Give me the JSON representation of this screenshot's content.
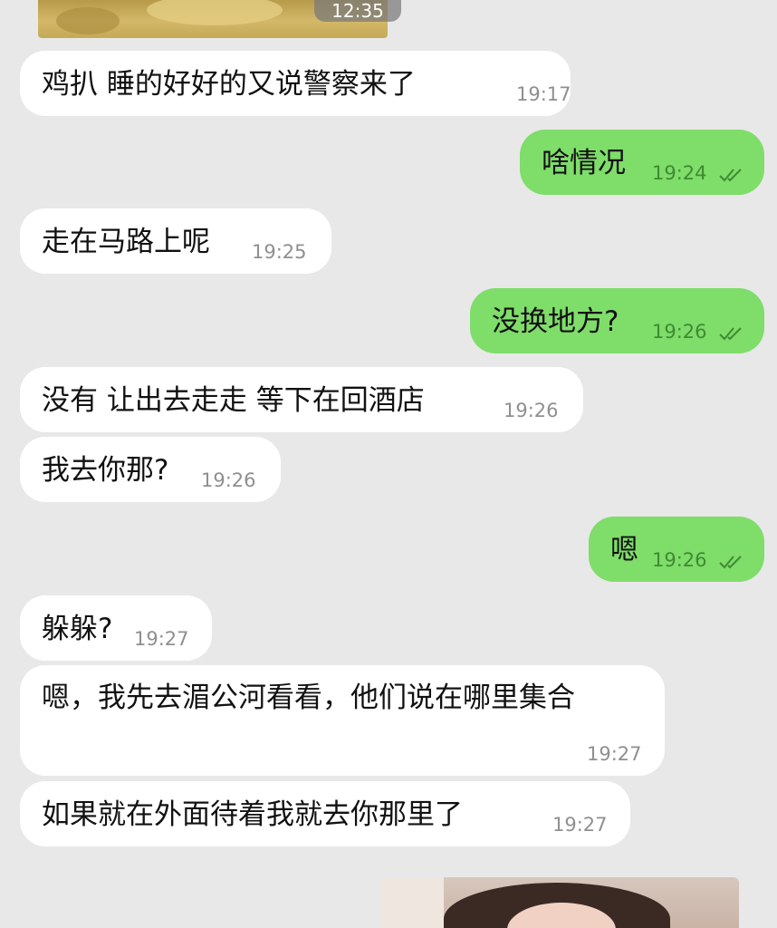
{
  "top_media": {
    "timestamp_overlay": "12:35"
  },
  "messages": [
    {
      "dir": "in",
      "text": "鸡扒 睡的好好的又说警察来了",
      "time": "19:17"
    },
    {
      "dir": "out",
      "text": "啥情况",
      "time": "19:24",
      "read": true
    },
    {
      "dir": "in",
      "text": "走在马路上呢",
      "time": "19:25"
    },
    {
      "dir": "out",
      "text": "没换地方?",
      "time": "19:26",
      "read": true
    },
    {
      "dir": "in",
      "text": "没有 让出去走走 等下在回酒店",
      "time": "19:26"
    },
    {
      "dir": "in",
      "text": "我去你那?",
      "time": "19:26"
    },
    {
      "dir": "out",
      "text": "嗯",
      "time": "19:26",
      "read": true
    },
    {
      "dir": "in",
      "text": "躲躲?",
      "time": "19:27"
    },
    {
      "dir": "in",
      "text": "嗯，我先去湄公河看看，他们说在哪里集合",
      "time": "19:27"
    },
    {
      "dir": "in",
      "text": "如果就在外面待着我就去你那里了",
      "time": "19:27"
    }
  ],
  "colors": {
    "background": "#e8e8e9",
    "incoming_bubble": "#ffffff",
    "outgoing_bubble": "#7fdd6a",
    "read_check": "#3f8a33"
  },
  "icons": {
    "read_receipt": "double-check-icon"
  }
}
